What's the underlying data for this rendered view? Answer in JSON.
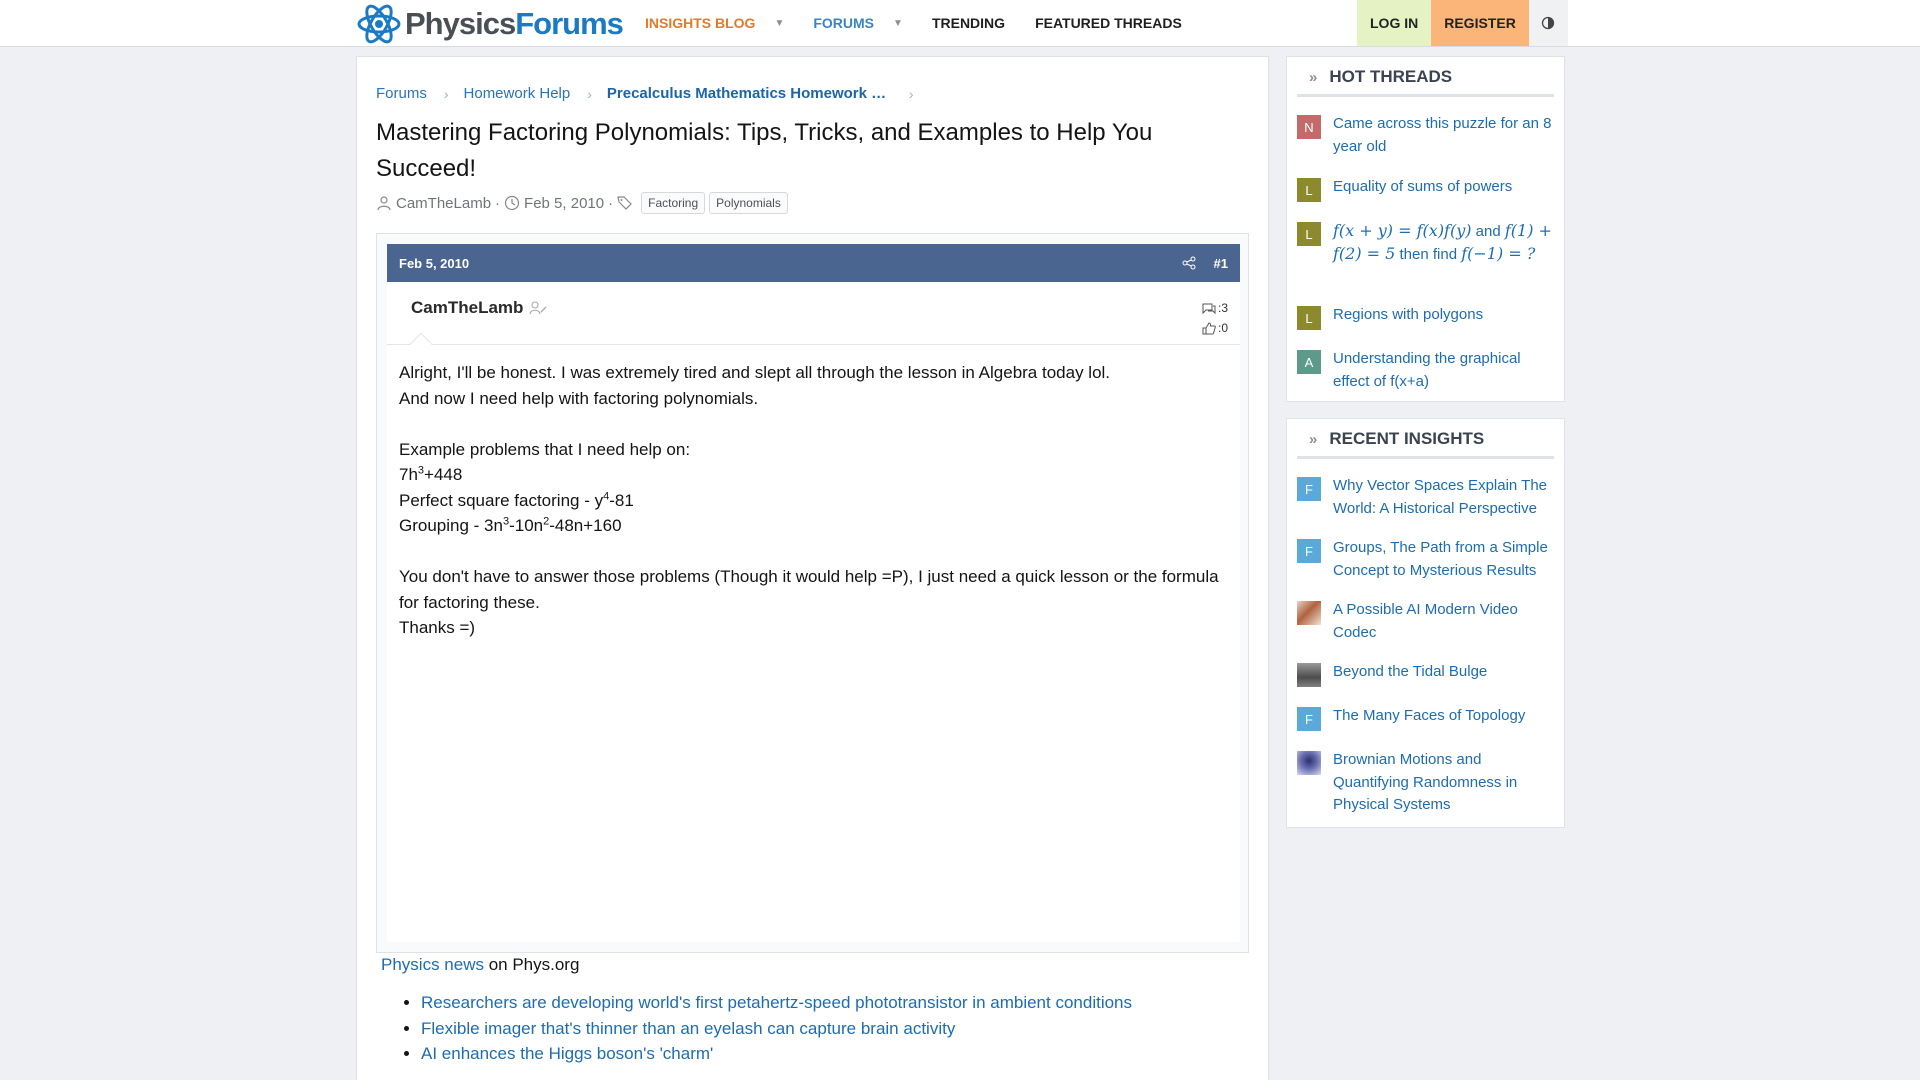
{
  "topbar": {
    "logo_part1": "Physics",
    "logo_part2": "Forums",
    "nav": [
      {
        "label": "INSIGHTS BLOG"
      },
      {
        "label": "FORUMS"
      },
      {
        "label": "TRENDING"
      },
      {
        "label": "FEATURED THREADS"
      }
    ],
    "login": "LOG IN",
    "register": "REGISTER"
  },
  "breadcrumb": [
    "Forums",
    "Homework Help",
    "Precalculus Mathematics Homework Help"
  ],
  "thread": {
    "title": "Mastering Factoring Polynomials: Tips, Tricks, and Examples to Help You Succeed!",
    "author": "CamTheLamb",
    "date": "Feb 5, 2010",
    "tags": [
      "Factoring",
      "Polynomials"
    ]
  },
  "post": {
    "date": "Feb 5, 2010",
    "number": "#1",
    "author": "CamTheLamb",
    "messages_stat": ":3",
    "reactions_stat": ":0",
    "lines": {
      "l1": "Alright, I'll be honest. I was extremely tired and slept all through the lesson in Algebra today lol.",
      "l2": "And now I need help with factoring polynomials.",
      "l3": "Example problems that I need help on:",
      "l4a": "7h",
      "l4b": "3",
      "l4c": "+448",
      "l5a": "Perfect square factoring - y",
      "l5b": "4",
      "l5c": "-81",
      "l6a": "Grouping - 3n",
      "l6b": "3",
      "l6c": "-10n",
      "l6d": "2",
      "l6e": "-48n+160",
      "l7": "You don't have to answer those problems (Though it would help =P), I just need a quick lesson or the formula for factoring these.",
      "l8": "Thanks =)"
    }
  },
  "news": {
    "link": "Physics news",
    "suffix": " on Phys.org",
    "items": [
      "Researchers are developing world's first petahertz-speed phototransistor in ambient conditions",
      "Flexible imager that's thinner than an eyelash can capture brain activity",
      "AI enhances the Higgs boson's 'charm'"
    ]
  },
  "hot_threads": {
    "title": "HOT THREADS",
    "items": [
      {
        "avatar": "N",
        "title": "Came across this puzzle for an 8 year old"
      },
      {
        "avatar": "L",
        "title": "Equality of sums of powers"
      },
      {
        "avatar": "L",
        "title_math1": "f(x + y) = f(x)f(y)",
        "title_t1": " and ",
        "title_math2": "f(1) + f(2) = 5",
        "title_t2": " then find ",
        "title_math3": "f(−1) = ?"
      },
      {
        "avatar": "L",
        "title": "Regions with polygons"
      },
      {
        "avatar": "A",
        "title": "Understanding the graphical effect of f(x+a)"
      }
    ]
  },
  "recent_insights": {
    "title": "RECENT INSIGHTS",
    "items": [
      {
        "avatar": "F",
        "title": "Why Vector Spaces Explain The World: A Historical Perspective"
      },
      {
        "avatar": "F",
        "title": "Groups, The Path from a Simple Concept to Mysterious Results"
      },
      {
        "avatar": "",
        "title": "A Possible AI Modern Video Codec"
      },
      {
        "avatar": "",
        "title": "Beyond the Tidal Bulge"
      },
      {
        "avatar": "F",
        "title": "The Many Faces of Topology"
      },
      {
        "avatar": "",
        "title": "Brownian Motions and Quantifying Randomness in Physical Systems"
      }
    ]
  },
  "colors": {
    "accent_orange": "#e07a2c",
    "link_blue": "#1e6cb0",
    "post_header": "#4a6590",
    "login_bg": "#e5f3c4",
    "register_bg": "#fbb579"
  }
}
